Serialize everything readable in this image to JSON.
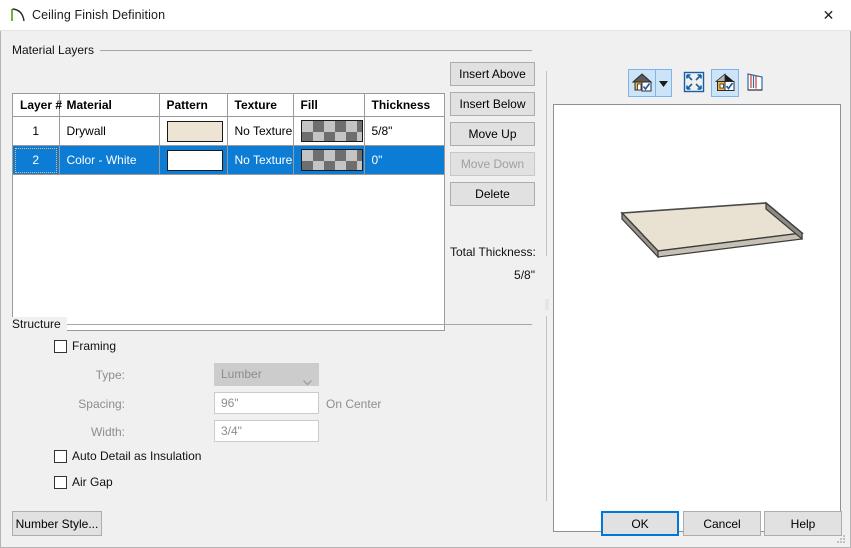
{
  "window": {
    "title": "Ceiling Finish Definition",
    "icon": "ceiling-arc-icon",
    "close_label": "✕"
  },
  "material_layers": {
    "group_label": "Material Layers",
    "columns": [
      "Layer #",
      "Material",
      "Pattern",
      "Texture",
      "Fill",
      "Thickness"
    ],
    "rows": [
      {
        "layer": "1",
        "material": "Drywall",
        "pattern_color": "#ede4d3",
        "texture": "No Texture",
        "fill": "checkerboard",
        "thickness": "5/8\"",
        "selected": false
      },
      {
        "layer": "2",
        "material": "Color - White",
        "pattern_color": "#ffffff",
        "texture": "No Texture",
        "fill": "checkerboard",
        "thickness": "0\"",
        "selected": true
      }
    ],
    "buttons": {
      "insert_above": "Insert Above",
      "insert_below": "Insert Below",
      "move_up": "Move Up",
      "move_down": "Move Down",
      "delete": "Delete"
    },
    "total_thickness_label": "Total Thickness:",
    "total_thickness_value": "5/8\""
  },
  "preview": {
    "toolbar": {
      "view_mode": "house-view-icon",
      "view_mode_dropdown": "chevron-down-icon",
      "fit_to_screen": "fit-to-screen-icon",
      "material_view": "house-material-icon",
      "layers_view": "wall-layers-icon"
    }
  },
  "structure": {
    "group_label": "Structure",
    "framing_label": "Framing",
    "framing_checked": false,
    "type_label": "Type:",
    "type_value": "Lumber",
    "spacing_label": "Spacing:",
    "spacing_value": "96\"",
    "on_center_label": "On Center",
    "width_label": "Width:",
    "width_value": "3/4\"",
    "auto_detail_label": "Auto Detail as Insulation",
    "auto_detail_checked": false,
    "air_gap_label": "Air Gap",
    "air_gap_checked": false
  },
  "footer": {
    "number_style": "Number Style...",
    "ok": "OK",
    "cancel": "Cancel",
    "help": "Help"
  },
  "colors": {
    "selection_blue": "#0c7cd5",
    "accent_focus": "#0078d7",
    "dialog_bg": "#f0f0f0"
  }
}
